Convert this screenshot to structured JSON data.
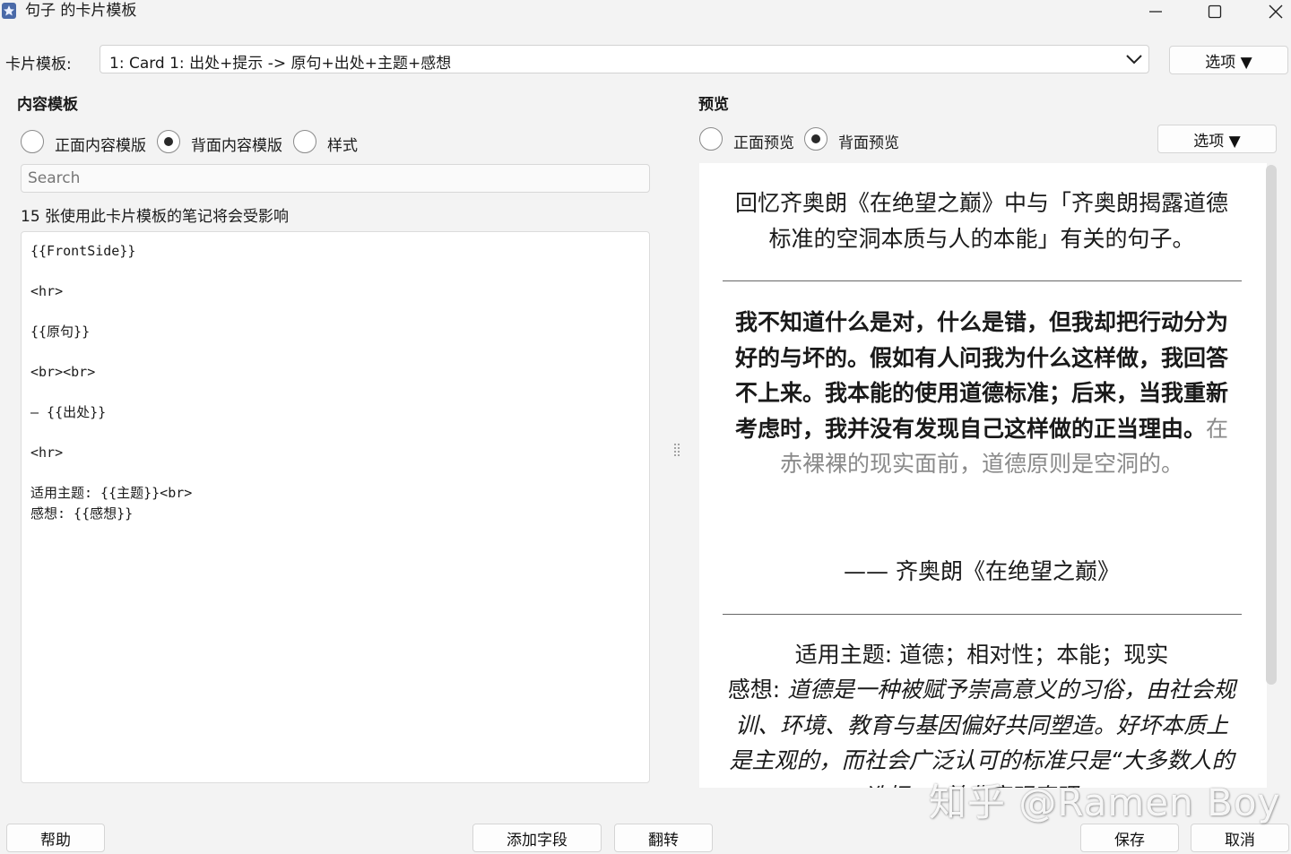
{
  "window": {
    "title": "句子 的卡片模板",
    "minimize_glyph": "—",
    "maximize_glyph": "☐",
    "close_glyph": "✕"
  },
  "template_select": {
    "label": "卡片模板:",
    "value": "1: Card 1: 出处+提示 -> 原句+出处+主题+感想",
    "options_button": "选项 ▼"
  },
  "content": {
    "heading": "内容模板",
    "radios": [
      {
        "label": "正面内容模版",
        "checked": false
      },
      {
        "label": "背面内容模版",
        "checked": true
      },
      {
        "label": "样式",
        "checked": false
      }
    ],
    "search_placeholder": "Search",
    "affected_notes": "15 张使用此卡片模板的笔记将会受影响",
    "editor_text": "{{FrontSide}}\n\n<hr>\n\n{{原句}}\n\n<br><br>\n\n— {{出处}}\n\n<hr>\n\n适用主题: {{主题}}<br>\n感想: {{感想}}"
  },
  "preview": {
    "heading": "预览",
    "radios": [
      {
        "label": "正面预览",
        "checked": false
      },
      {
        "label": "背面预览",
        "checked": true
      }
    ],
    "options_button": "选项 ▼",
    "prompt_text": "回忆齐奥朗《在绝望之巅》中与「齐奥朗揭露道德标准的空洞本质与人的本能」有关的句子。",
    "quote_bold": "我不知道什么是对，什么是错，但我却把行动分为好的与坏的。假如有人问我为什么这样做，我回答不上来。我本能的使用道德标准；后来，当我重新考虑时，我并没有发现自己这样做的正当理由。",
    "quote_gray": "在赤裸裸的现实面前，道德原则是空洞的。",
    "source": "—— 齐奥朗《在绝望之巅》",
    "topics_label": "适用主题:",
    "topics_value": "道德；相对性；本能；现实",
    "thoughts_label": "感想:",
    "thoughts_value": "道德是一种被赋予崇高意义的习俗，由社会规训、环境、教育与基因偏好共同塑造。好坏本质上是主观的，而社会广泛认可的标准只是“大多数人的选择”，并非客观真理。"
  },
  "footer": {
    "help": "帮助",
    "add_field": "添加字段",
    "flip": "翻转",
    "save": "保存",
    "cancel": "取消"
  },
  "watermark": "知乎 @Ramen Boy"
}
